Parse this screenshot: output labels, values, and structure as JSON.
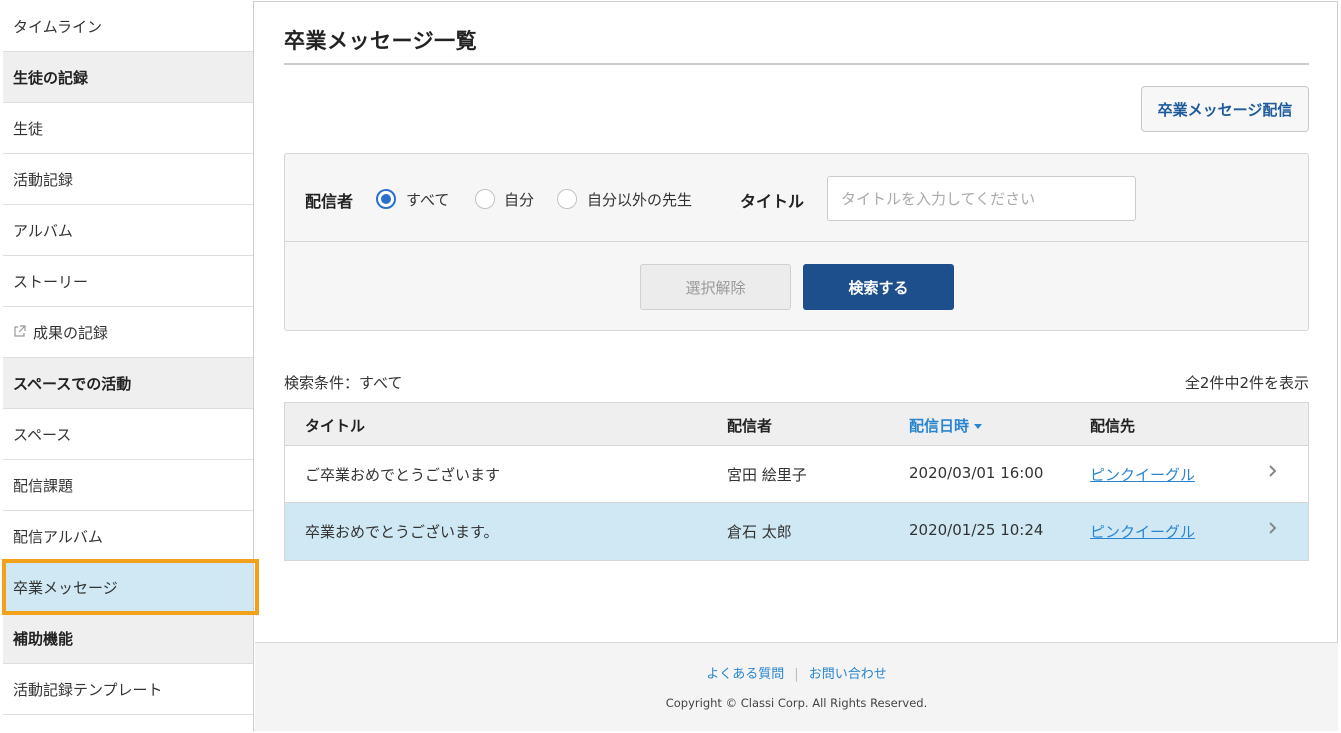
{
  "sidebar": {
    "items": [
      {
        "label": "タイムライン",
        "type": "item"
      },
      {
        "label": "生徒の記録",
        "type": "header"
      },
      {
        "label": "生徒",
        "type": "item"
      },
      {
        "label": "活動記録",
        "type": "item"
      },
      {
        "label": "アルバム",
        "type": "item"
      },
      {
        "label": "ストーリー",
        "type": "item"
      },
      {
        "label": "成果の記録",
        "type": "item",
        "icon": "external-link-icon"
      },
      {
        "label": "スペースでの活動",
        "type": "header"
      },
      {
        "label": "スペース",
        "type": "item"
      },
      {
        "label": "配信課題",
        "type": "item"
      },
      {
        "label": "配信アルバム",
        "type": "item"
      },
      {
        "label": "卒業メッセージ",
        "type": "item",
        "active": true
      },
      {
        "label": "補助機能",
        "type": "header"
      },
      {
        "label": "活動記録テンプレート",
        "type": "item"
      }
    ]
  },
  "main": {
    "page_title": "卒業メッセージ一覧",
    "deliver_button": "卒業メッセージ配信"
  },
  "search": {
    "sender_label": "配信者",
    "radios": [
      {
        "label": "すべて",
        "checked": true
      },
      {
        "label": "自分",
        "checked": false
      },
      {
        "label": "自分以外の先生",
        "checked": false
      }
    ],
    "title_label": "タイトル",
    "title_placeholder": "タイトルを入力してください",
    "title_value": "",
    "clear_button": "選択解除",
    "search_button": "検索する"
  },
  "results": {
    "condition": "検索条件：すべて",
    "count": "全2件中2件を表示",
    "columns": [
      "タイトル",
      "配信者",
      "配信日時",
      "配信先"
    ],
    "sorted_column": "配信日時",
    "rows": [
      {
        "title": "ご卒業おめでとうございます",
        "sender": "宮田 絵里子",
        "datetime": "2020/03/01 16:00",
        "destination": "ピンクイーグル",
        "selected": false
      },
      {
        "title": "卒業おめでとうございます。",
        "sender": "倉石 太郎",
        "datetime": "2020/01/25 10:24",
        "destination": "ピンクイーグル",
        "selected": true
      }
    ]
  },
  "footer": {
    "faq": "よくある質問",
    "contact": "お問い合わせ",
    "copyright": "Copyright © Classi Corp. All Rights Reserved."
  },
  "colors": {
    "accent": "#1d4f8c",
    "link": "#2a85d0",
    "highlight_border": "#f2a21a",
    "selected_row": "#cfe8f3"
  }
}
